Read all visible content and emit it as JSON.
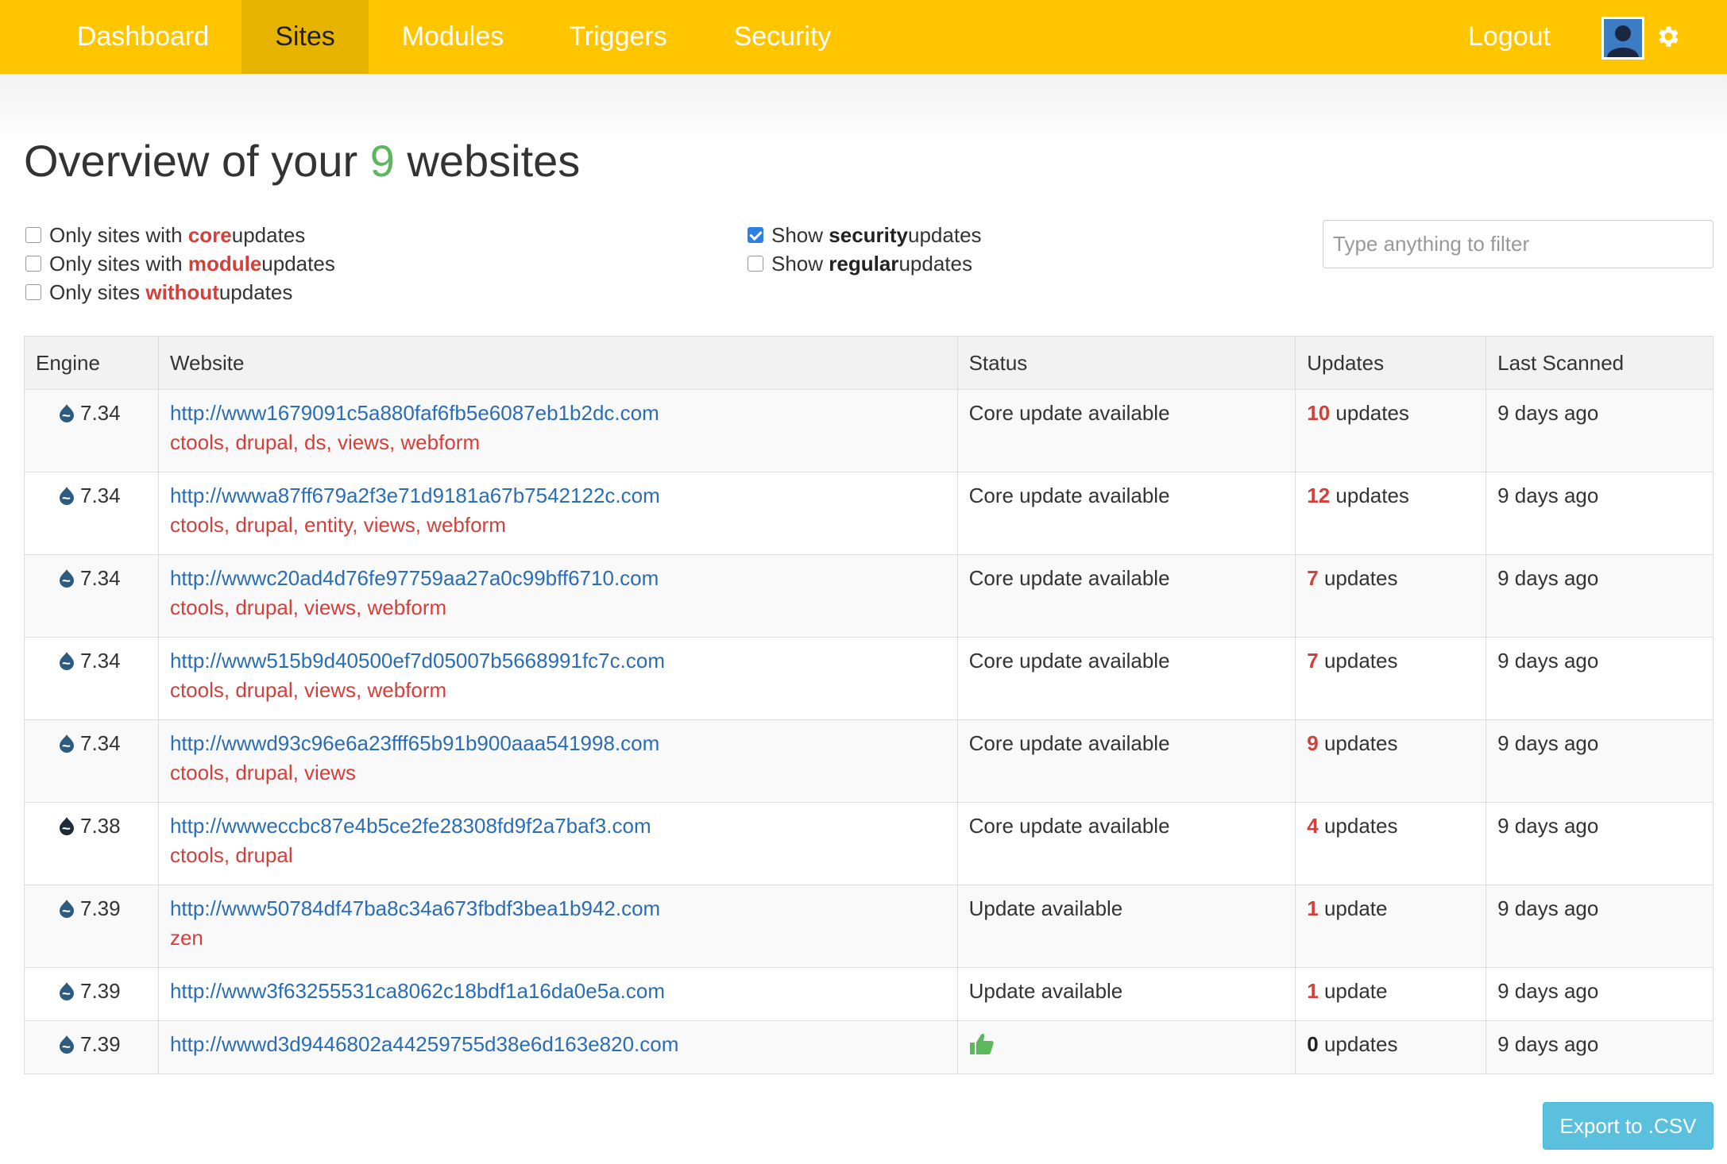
{
  "nav": {
    "items": [
      {
        "label": "Dashboard",
        "active": false
      },
      {
        "label": "Sites",
        "active": true
      },
      {
        "label": "Modules",
        "active": false
      },
      {
        "label": "Triggers",
        "active": false
      },
      {
        "label": "Security",
        "active": false
      }
    ],
    "logout": "Logout",
    "brand_color": "#ffc600",
    "active_color": "#e6b300"
  },
  "heading": {
    "prefix": "Overview of your ",
    "count": "9",
    "suffix": " websites"
  },
  "filters": {
    "core": {
      "pre": "Only sites with ",
      "em": "core",
      "post": " updates",
      "checked": false
    },
    "module": {
      "pre": "Only sites with ",
      "em": "module",
      "post": " updates",
      "checked": false
    },
    "without": {
      "pre": "Only sites ",
      "em": "without",
      "post": " updates",
      "checked": false
    },
    "security": {
      "pre": "Show ",
      "em": "security",
      "post": " updates",
      "checked": true
    },
    "regular": {
      "pre": "Show ",
      "em": "regular",
      "post": " updates",
      "checked": false
    },
    "search_placeholder": "Type anything to filter"
  },
  "table": {
    "headers": [
      "Engine",
      "Website",
      "Status",
      "Updates",
      "Last Scanned"
    ],
    "rows": [
      {
        "engine": "7.34",
        "url": "http://www1679091c5a880faf6fb5e6087eb1b2dc.com",
        "modules": "ctools, drupal, ds, views, webform",
        "status": "Core update available",
        "count": "10",
        "unit": " updates",
        "scanned": "9 days ago"
      },
      {
        "engine": "7.34",
        "url": "http://wwwa87ff679a2f3e71d9181a67b7542122c.com",
        "modules": "ctools, drupal, entity, views, webform",
        "status": "Core update available",
        "count": "12",
        "unit": " updates",
        "scanned": "9 days ago"
      },
      {
        "engine": "7.34",
        "url": "http://wwwc20ad4d76fe97759aa27a0c99bff6710.com",
        "modules": "ctools, drupal, views, webform",
        "status": "Core update available",
        "count": "7",
        "unit": " updates",
        "scanned": "9 days ago"
      },
      {
        "engine": "7.34",
        "url": "http://www515b9d40500ef7d05007b5668991fc7c.com",
        "modules": "ctools, drupal, views, webform",
        "status": "Core update available",
        "count": "7",
        "unit": " updates",
        "scanned": "9 days ago"
      },
      {
        "engine": "7.34",
        "url": "http://wwwd93c96e6a23fff65b91b900aaa541998.com",
        "modules": "ctools, drupal, views",
        "status": "Core update available",
        "count": "9",
        "unit": " updates",
        "scanned": "9 days ago"
      },
      {
        "engine": "7.38",
        "url": "http://wwweccbc87e4b5ce2fe28308fd9f2a7baf3.com",
        "modules": "ctools, drupal",
        "status": "Core update available",
        "count": "4",
        "unit": " updates",
        "scanned": "9 days ago"
      },
      {
        "engine": "7.39",
        "url": "http://www50784df47ba8c34a673fbdf3bea1b942.com",
        "modules": "zen",
        "status": "Update available",
        "count": "1",
        "unit": " update",
        "scanned": "9 days ago"
      },
      {
        "engine": "7.39",
        "url": "http://www3f63255531ca8062c18bdf1a16da0e5a.com",
        "modules": "",
        "status": "Update available",
        "count": "1",
        "unit": " update",
        "scanned": "9 days ago"
      },
      {
        "engine": "7.39",
        "url": "http://wwwd3d9446802a44259755d38e6d163e820.com",
        "modules": "",
        "status": "",
        "status_icon": "thumbs-up-icon",
        "count": "0",
        "unit": " updates",
        "scanned": "9 days ago"
      }
    ]
  },
  "export_label": "Export to .CSV",
  "icons": {
    "engine": "drupal-drop-icon",
    "settings": "gear-icon",
    "avatar": "user-avatar-icon"
  }
}
